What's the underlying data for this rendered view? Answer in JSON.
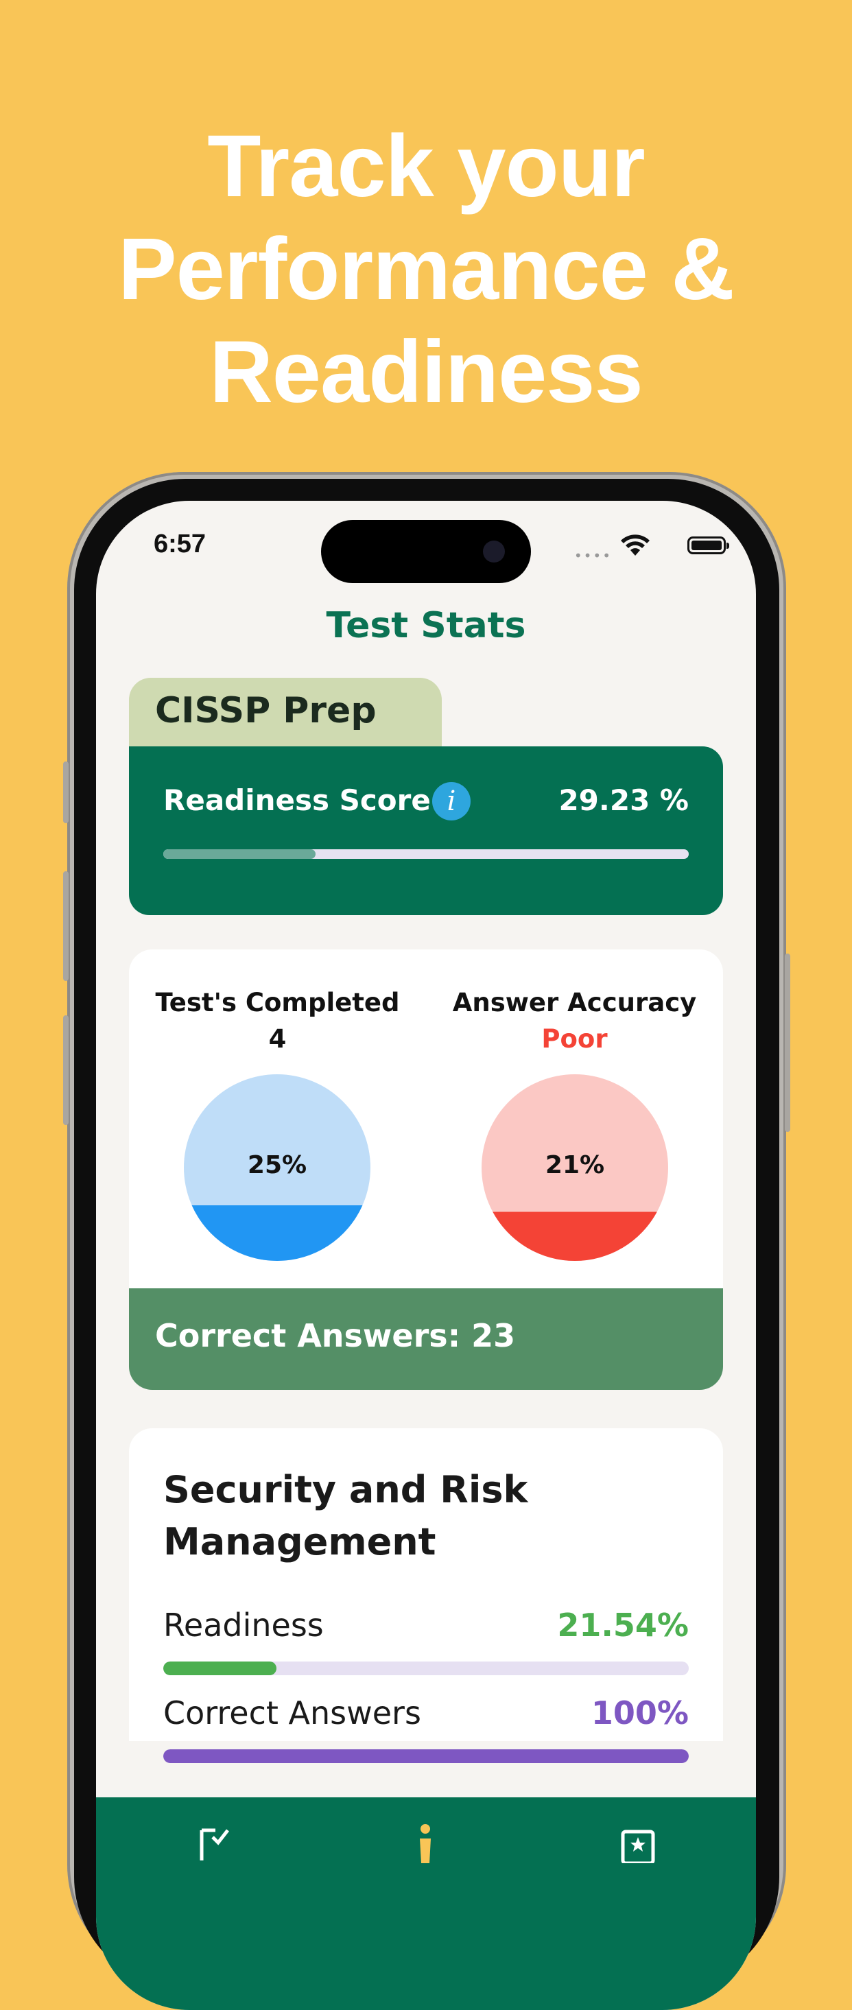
{
  "headline": {
    "lines": [
      "Track your",
      "Performance &",
      "Readiness"
    ]
  },
  "status_bar": {
    "time": "6:57"
  },
  "screen": {
    "title": "Test Stats",
    "exam_tab": "CISSP Prep",
    "readiness": {
      "label": "Readiness Score",
      "info_icon": "i",
      "value": "29.23 %",
      "progress": 0.29
    },
    "stats": {
      "tests_completed": {
        "label": "Test's Completed",
        "value": "4",
        "pie_label": "25%",
        "percent": 25,
        "color": "#2196F3",
        "light_color": "#BFDDF8"
      },
      "accuracy": {
        "label": "Answer Accuracy",
        "value": "Poor",
        "value_color": "#F44336",
        "pie_label": "21%",
        "percent": 21,
        "color": "#F44336",
        "light_color": "#FBC8C4"
      },
      "correct_answers": "Correct Answers: 23"
    },
    "topic": {
      "title": "Security and Risk Management",
      "readiness_label": "Readiness",
      "readiness_value": "21.54%",
      "readiness_progress": 0.2154,
      "readiness_color": "#4CAF50",
      "correct_label": "Correct Answers",
      "correct_value": "100%",
      "correct_progress": 1.0,
      "correct_color": "#7E57C2"
    },
    "tabbar": {
      "icons": [
        "checklist-icon",
        "person-icon",
        "star-icon"
      ],
      "active_color": "#F9C557"
    }
  }
}
